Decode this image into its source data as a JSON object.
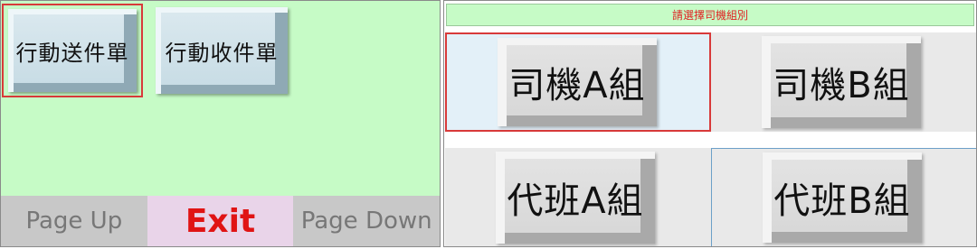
{
  "left": {
    "buttons": [
      {
        "label": "行動送件單"
      },
      {
        "label": "行動收件單"
      }
    ],
    "footer": {
      "page_up": "Page Up",
      "exit": "Exit",
      "page_down": "Page Down"
    }
  },
  "right": {
    "title": "請選擇司機組別",
    "groups": [
      {
        "label": "司機A組"
      },
      {
        "label": "司機B組"
      },
      {
        "label": "代班A組"
      },
      {
        "label": "代班B組"
      }
    ]
  },
  "colors": {
    "panel_green": "#c6fbc6",
    "exit_red": "#e01414",
    "selection_border": "#d83a3a",
    "exit_bg": "#e9d4e9"
  }
}
